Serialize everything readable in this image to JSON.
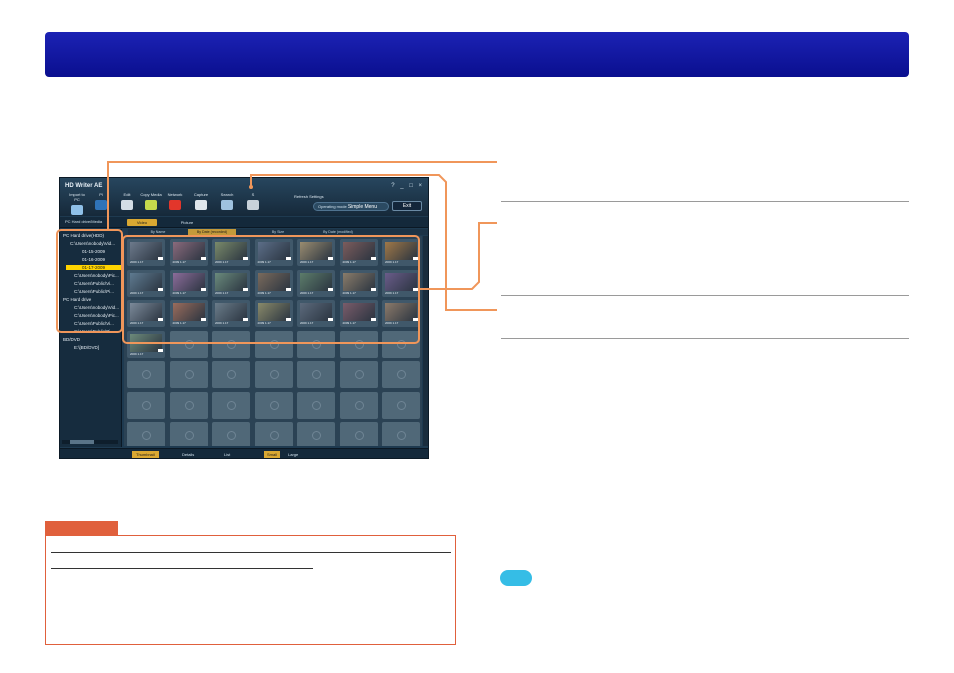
{
  "app": {
    "title": "HD Writer AE",
    "window_controls": "? _ □ ×",
    "toolbar": [
      {
        "label": "Import to PC",
        "icon": "import-icon",
        "color": "#8fc0e8"
      },
      {
        "label": "Pl",
        "icon": "play-icon",
        "color": "#2f73b8"
      },
      {
        "label": "Edit",
        "icon": "edit-icon",
        "color": "#d3dde6"
      },
      {
        "label": "Copy Media",
        "icon": "copy-media-icon",
        "color": "#c6d94c"
      },
      {
        "label": "Network",
        "icon": "youtube-icon",
        "color": "#e2362b"
      },
      {
        "label": "Capture",
        "icon": "camera-icon",
        "color": "#dfe6ec"
      },
      {
        "label": "Search",
        "icon": "search-icon",
        "color": "#9fc2df"
      },
      {
        "label": "S",
        "icon": "delete-icon",
        "color": "#c8d2da"
      }
    ],
    "refresh_label": "Refresh",
    "settings_label": "Settings",
    "operating_mode_label": "Operating mode",
    "operating_mode_value": "Simple Menu",
    "exit_label": "Exit",
    "location_label": "PC Hard drive/Media",
    "media_tabs": {
      "video": "Video",
      "picture": "Picture"
    },
    "sort_tabs": [
      "By Name",
      "By Date (recorded)",
      "By Size",
      "By Date (modified)"
    ],
    "tree": [
      {
        "label": "PC Hard drive(HDD)",
        "selected": false
      },
      {
        "label": "C:\\Users\\nobody\\Vid...",
        "selected": false
      },
      {
        "label": "01-15-2009",
        "selected": false
      },
      {
        "label": "01-16-2009",
        "selected": false
      },
      {
        "label": "01-17-2009",
        "selected": true
      },
      {
        "label": "C:\\Users\\nobody\\Pic...",
        "selected": false
      },
      {
        "label": "C:\\Users\\Public\\Vi...",
        "selected": false
      },
      {
        "label": "C:\\Users\\Public\\Pi...",
        "selected": false
      },
      {
        "label": "PC Hard drive",
        "selected": false
      },
      {
        "label": "C:\\Users\\nobody\\Vid...",
        "selected": false
      },
      {
        "label": "C:\\Users\\nobody\\Pic...",
        "selected": false
      },
      {
        "label": "C:\\Users\\Public\\Vi...",
        "selected": false
      },
      {
        "label": "C:\\Users\\Public\\Pi...",
        "selected": false
      },
      {
        "label": "BD/DVD",
        "selected": false
      },
      {
        "label": "E:\\[BD/DVD]",
        "selected": false
      }
    ],
    "thumbnail_caption": "2009  1.17",
    "thumbnail_colors": [
      "#6d7a8c",
      "#8a6a7c",
      "#7a8a6a",
      "#5c6e88",
      "#9a8c70",
      "#7c5c5c",
      "#a07848",
      "#5e7a90",
      "#8c6c9a",
      "#6a8a7c",
      "#7a6a5c",
      "#5c7c6a",
      "#8a7c6a",
      "#6a5c8a",
      "#7c8a9a",
      "#9a6c5c",
      "#6a7c8a",
      "#8a8a6a",
      "#5c6a7c",
      "#7a5c6a",
      "#8c7a6a",
      "#6c8a7a"
    ],
    "view_modes": [
      "Thumbnail",
      "Details",
      "List"
    ],
    "size_modes": [
      "Small",
      "Large"
    ]
  }
}
